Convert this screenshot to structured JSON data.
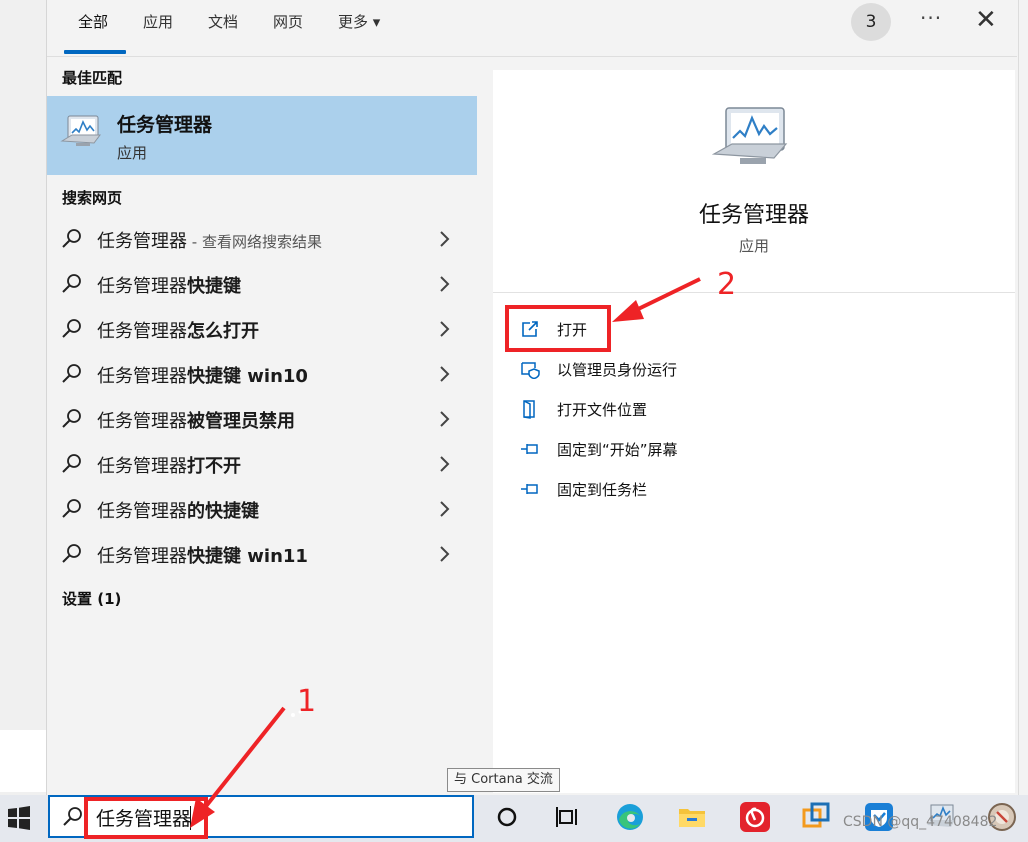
{
  "tabs": [
    "全部",
    "应用",
    "文档",
    "网页",
    "更多 ▾"
  ],
  "header": {
    "badge": "3",
    "more": "···",
    "close": "✕"
  },
  "left": {
    "best_match_title": "最佳匹配",
    "best_match": {
      "name": "任务管理器",
      "type": "应用"
    },
    "web_title": "搜索网页",
    "web_results": [
      {
        "prefix": "任务管理器",
        "suffix": " - 查看网络搜索结果",
        "bold": ""
      },
      {
        "prefix": "任务管理器",
        "bold": "快捷键",
        "suffix": ""
      },
      {
        "prefix": "任务管理器",
        "bold": "怎么打开",
        "suffix": ""
      },
      {
        "prefix": "任务管理器",
        "bold": "快捷键 win10",
        "suffix": ""
      },
      {
        "prefix": "任务管理器",
        "bold": "被管理员禁用",
        "suffix": ""
      },
      {
        "prefix": "任务管理器",
        "bold": "打不开",
        "suffix": ""
      },
      {
        "prefix": "任务管理器",
        "bold": "的快捷键",
        "suffix": ""
      },
      {
        "prefix": "任务管理器",
        "bold": "快捷键 win11",
        "suffix": ""
      }
    ],
    "settings_title": "设置 (1)"
  },
  "right": {
    "app_name": "任务管理器",
    "app_type": "应用",
    "actions": [
      "打开",
      "以管理员身份运行",
      "打开文件位置",
      "固定到“开始”屏幕",
      "固定到任务栏"
    ]
  },
  "tooltip": "与 Cortana 交流",
  "search": {
    "value": "任务管理器"
  },
  "annotations": {
    "label1": "1",
    "label2": "2"
  },
  "watermark": "CSDN @qq_47408482",
  "colors": {
    "accent": "#0067c0",
    "highlight": "#abd0ec",
    "annotation_red": "#ee2326"
  }
}
